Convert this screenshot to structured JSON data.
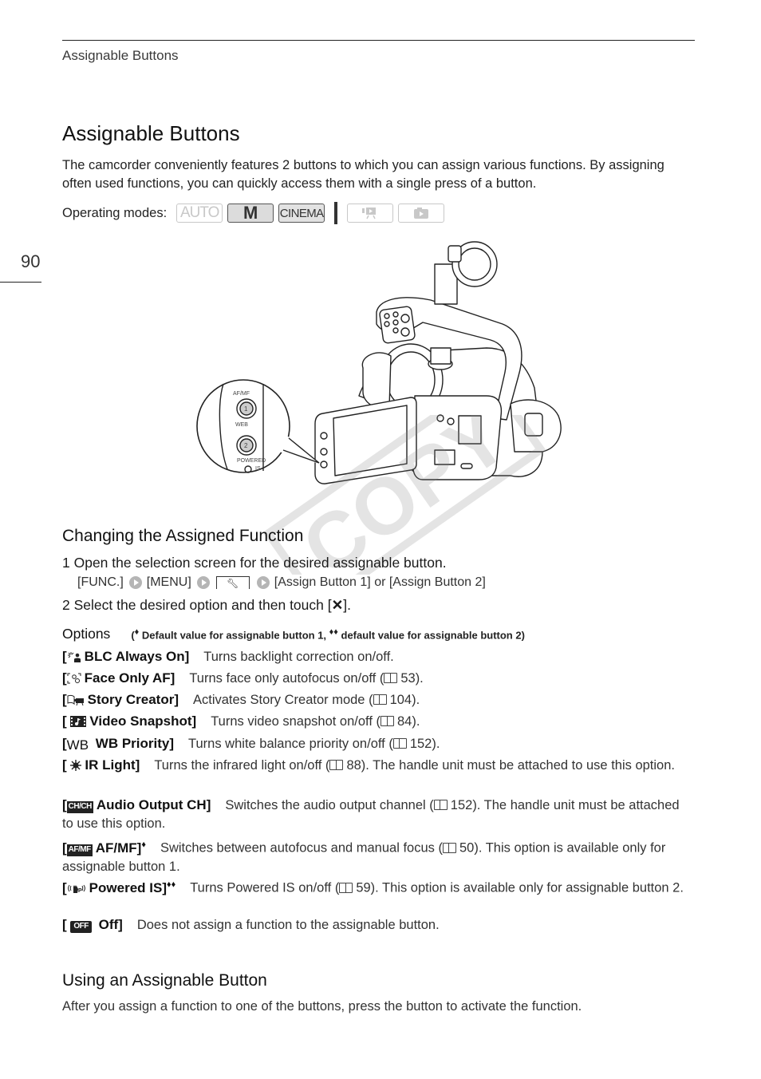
{
  "header": {
    "running_head": "Assignable Buttons",
    "page_number": "90"
  },
  "title": "Assignable Buttons",
  "intro": "The camcorder conveniently features 2 buttons to which you can assign various functions. By assigning often used functions, you can quickly access them with a single press of a button.",
  "operating_modes": {
    "label": "Operating modes:",
    "modes": [
      {
        "name": "AUTO",
        "active": false
      },
      {
        "name": "M",
        "active": true
      },
      {
        "name": "CINEMA",
        "active": true
      },
      {
        "name": "video-playback",
        "active": false
      },
      {
        "name": "photo-playback",
        "active": false
      }
    ]
  },
  "illustration": {
    "button1_top_label": "AF/MF",
    "button1_number": "1",
    "button1_bottom_label": "WEB",
    "button2_number": "2",
    "button2_label": "POWERED",
    "button2_sub": "IS"
  },
  "section_change": {
    "heading": "Changing the Assigned Function",
    "step1": "1  Open the selection screen for the desired assignable button.",
    "path": [
      "[FUNC.]",
      "[MENU]",
      "wrench-tab",
      "[Assign Button 1] or [Assign Button 2]"
    ],
    "step2_prefix": "2  Select the desired option and then touch [",
    "step2_icon": "✕",
    "step2_suffix": "]."
  },
  "options": {
    "label": "Options",
    "note_open": "(",
    "note_mark1": "♦",
    "note_text1": " Default value for assignable button 1, ",
    "note_mark2": "♦♦",
    "note_text2": " default value for assignable button 2)",
    "items": [
      {
        "icon": "blc-icon",
        "name": "BLC Always On]",
        "mark": "",
        "desc": "Turns backlight correction on/off.",
        "ref": "",
        "desc_after": ""
      },
      {
        "icon": "face-af-icon",
        "name": "Face Only AF]",
        "mark": "",
        "desc": "Turns face only autofocus on/off (",
        "ref": "53",
        "desc_after": ")."
      },
      {
        "icon": "story-creator-icon",
        "name": "Story Creator]",
        "mark": "",
        "desc": "Activates Story Creator mode (",
        "ref": "104",
        "desc_after": ")."
      },
      {
        "icon": "video-snapshot-icon",
        "name": "Video Snapshot]",
        "mark": "",
        "desc": "Turns video snapshot on/off (",
        "ref": "84",
        "desc_after": ")."
      },
      {
        "icon": "wb-icon",
        "icon_text": "WB",
        "name": "WB Priority]",
        "mark": "",
        "desc": "Turns white balance priority on/off (",
        "ref": "152",
        "desc_after": ")."
      },
      {
        "icon": "ir-light-icon",
        "name": "IR Light]",
        "mark": "",
        "desc": "Turns the infrared light on/off (",
        "ref": "88",
        "desc_after": "). The handle unit must be attached to use this option."
      },
      {
        "icon": "audio-ch-icon",
        "icon_text": "CH/CH",
        "name": "Audio Output CH]",
        "mark": "",
        "desc": "Switches the audio output channel (",
        "ref": "152",
        "desc_after": "). The handle unit must be attached to use this option."
      },
      {
        "icon": "af-mf-icon",
        "icon_text": "AF/MF",
        "name": "AF/MF]",
        "mark": "♦",
        "desc": "Switches between autofocus and manual focus (",
        "ref": "50",
        "desc_after": "). This option is available only for assignable button 1."
      },
      {
        "icon": "powered-is-icon",
        "name": "Powered IS]",
        "mark": "♦♦",
        "desc": "Turns Powered IS on/off (",
        "ref": "59",
        "desc_after": "). This option is available only for assignable button 2."
      },
      {
        "icon": "off-icon",
        "icon_text": "OFF",
        "name": "Off]",
        "mark": "",
        "desc": "Does not assign a function to the assignable button.",
        "ref": "",
        "desc_after": ""
      }
    ]
  },
  "section_using": {
    "heading": "Using an Assignable Button",
    "text": "After you assign a function to one of the buttons, press the button to activate the function."
  },
  "watermark": "COPY"
}
